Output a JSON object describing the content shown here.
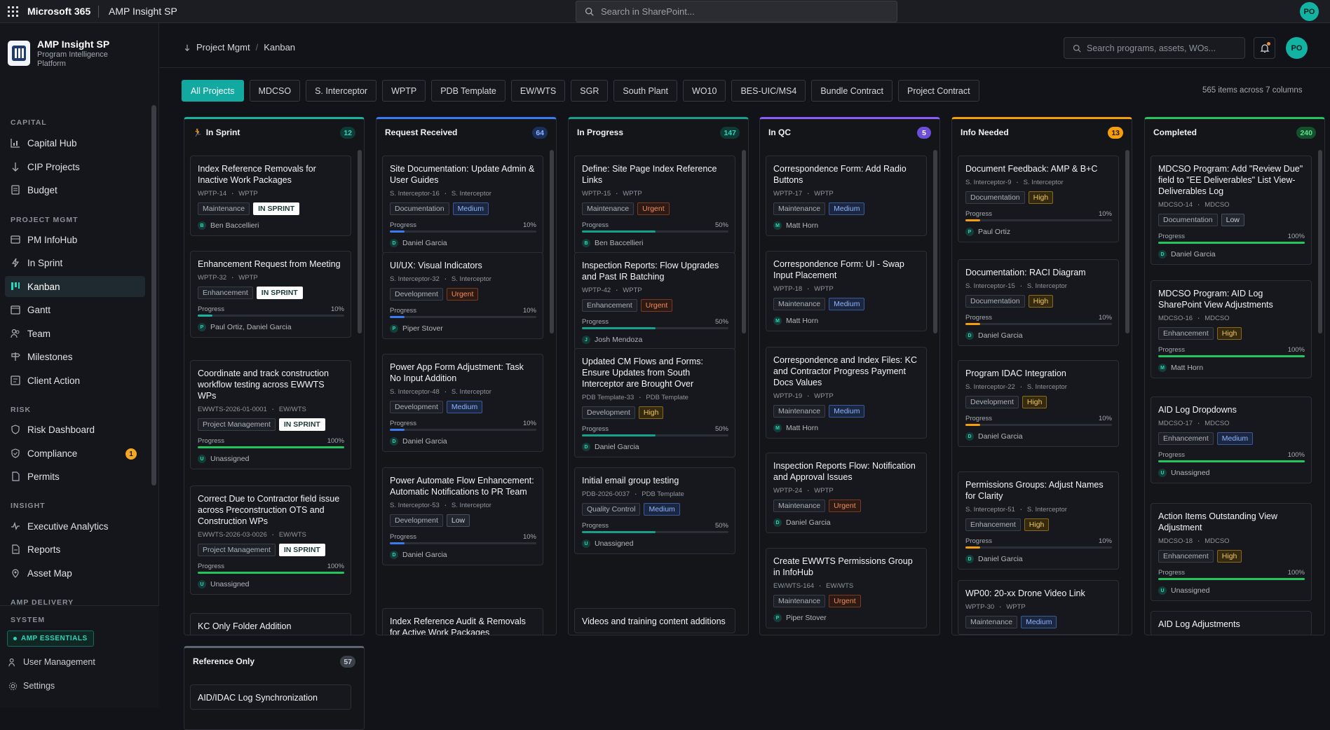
{
  "topbar": {
    "suite": "Microsoft 365",
    "app": "AMP Insight SP",
    "search_placeholder": "Search in SharePoint...",
    "avatar": "PO"
  },
  "brand": {
    "title": "AMP Insight SP",
    "subtitle": "Program Intelligence Platform"
  },
  "sidebar": {
    "sections": [
      {
        "label": "CAPITAL",
        "items": [
          {
            "label": "Capital Hub",
            "icon": "chart-icon"
          },
          {
            "label": "CIP Projects",
            "icon": "arrow-down-icon"
          },
          {
            "label": "Budget",
            "icon": "receipt-icon"
          }
        ]
      },
      {
        "label": "PROJECT MGMT",
        "items": [
          {
            "label": "PM InfoHub",
            "icon": "grid-icon"
          },
          {
            "label": "In Sprint",
            "icon": "bolt-icon"
          },
          {
            "label": "Kanban",
            "icon": "kanban-icon",
            "active": true
          },
          {
            "label": "Gantt",
            "icon": "calendar-icon"
          },
          {
            "label": "Team",
            "icon": "people-icon"
          },
          {
            "label": "Milestones",
            "icon": "signpost-icon"
          },
          {
            "label": "Client Action",
            "icon": "list-icon"
          }
        ]
      },
      {
        "label": "RISK",
        "items": [
          {
            "label": "Risk Dashboard",
            "icon": "shield-icon"
          },
          {
            "label": "Compliance",
            "icon": "shield-check-icon",
            "count": "1"
          },
          {
            "label": "Permits",
            "icon": "document-icon"
          }
        ]
      },
      {
        "label": "INSIGHT",
        "items": [
          {
            "label": "Executive Analytics",
            "icon": "pulse-icon"
          },
          {
            "label": "Reports",
            "icon": "report-icon"
          },
          {
            "label": "Asset Map",
            "icon": "pin-icon"
          }
        ]
      },
      {
        "label": "AMP DELIVERY",
        "items": []
      }
    ],
    "system": {
      "label": "SYSTEM",
      "badge": "AMP ESSENTIALS",
      "items": [
        {
          "label": "User Management"
        },
        {
          "label": "Settings"
        }
      ]
    }
  },
  "header": {
    "crumbs": [
      "Project Mgmt",
      "Kanban"
    ],
    "search_placeholder": "Search programs, assets, WOs...",
    "avatar": "PO"
  },
  "filters": [
    "All Projects",
    "MDCSO",
    "S. Interceptor",
    "WPTP",
    "PDB Template",
    "EW/WTS",
    "SGR",
    "South Plant",
    "WO10",
    "BES-UIC/MS4",
    "Bundle Contract",
    "Project Contract"
  ],
  "summary": "565 items across 7 columns",
  "labels": {
    "progress": "Progress"
  },
  "colors": {
    "accent": "#12a9a0",
    "urgent": "#f08c5a",
    "high": "#f5c65a",
    "medium": "#8fb4ff"
  },
  "columns": [
    {
      "title": "In Sprint",
      "count": "12",
      "color": "#19b3a3",
      "prefix": "🏃",
      "cards": [
        {
          "title": "Index Reference Removals for Inactive Work Packages",
          "code": "WPTP-14",
          "program": "WPTP",
          "tags": [
            "Maintenance"
          ],
          "sprint": "IN SPRINT",
          "assignee": "Ben Baccellieri",
          "initial": "B"
        },
        {
          "title": "Enhancement Request from Meeting",
          "code": "WPTP-32",
          "program": "WPTP",
          "tags": [
            "Enhancement"
          ],
          "sprint": "IN SPRINT",
          "progress": 10,
          "assignee": "Paul Ortiz, Daniel Garcia",
          "initial": "P"
        },
        {
          "title": "Coordinate and track construction workflow testing across EWWTS WPs",
          "code": "EWWTS-2026-01-0001",
          "program": "EW/WTS",
          "tags": [
            "Project Management"
          ],
          "sprint": "IN SPRINT",
          "progress": 100,
          "assignee": "Unassigned",
          "initial": "U"
        },
        {
          "title": "Correct Due to Contractor field issue across Preconstruction OTS and Construction WPs",
          "code": "EWWTS-2026-03-0026",
          "program": "EW/WTS",
          "tags": [
            "Project Management"
          ],
          "sprint": "IN SPRINT",
          "progress": 100,
          "assignee": "Unassigned",
          "initial": "U"
        },
        {
          "title": "KC Only Folder Addition"
        }
      ]
    },
    {
      "title": "Request Received",
      "count": "64",
      "color": "#3a7cf0",
      "cards": [
        {
          "title": "Site Documentation: Update Admin & User Guides",
          "code": "S. Interceptor-16",
          "program": "S. Interceptor",
          "tags": [
            "Documentation"
          ],
          "priority": "Medium",
          "progress": 10,
          "assignee": "Daniel Garcia",
          "initial": "D"
        },
        {
          "title": "UI/UX: Visual Indicators",
          "code": "S. Interceptor-32",
          "program": "S. Interceptor",
          "tags": [
            "Development"
          ],
          "priority": "Urgent",
          "progress": 10,
          "assignee": "Piper Stover",
          "initial": "P"
        },
        {
          "title": "Power App Form Adjustment: Task No Input Addition",
          "code": "S. Interceptor-48",
          "program": "S. Interceptor",
          "tags": [
            "Development"
          ],
          "priority": "Medium",
          "progress": 10,
          "assignee": "Daniel Garcia",
          "initial": "D"
        },
        {
          "title": "Power Automate Flow Enhancement: Automatic Notifications to PR Team",
          "code": "S. Interceptor-53",
          "program": "S. Interceptor",
          "tags": [
            "Development"
          ],
          "priority": "Low",
          "progress": 10,
          "assignee": "Daniel Garcia",
          "initial": "D"
        },
        {
          "title": "Index Reference Audit & Removals for Active Work Packages"
        }
      ]
    },
    {
      "title": "In Progress",
      "count": "147",
      "color": "#18a08f",
      "cards": [
        {
          "title": "Define: Site Page Index Reference Links",
          "code": "WPTP-15",
          "program": "WPTP",
          "tags": [
            "Maintenance"
          ],
          "priority": "Urgent",
          "progress": 50,
          "assignee": "Ben Baccellieri",
          "initial": "B"
        },
        {
          "title": "Inspection Reports: Flow Upgrades and Past IR Batching",
          "code": "WPTP-42",
          "program": "WPTP",
          "tags": [
            "Enhancement"
          ],
          "priority": "Urgent",
          "progress": 50,
          "assignee": "Josh Mendoza",
          "initial": "J"
        },
        {
          "title": "Updated CM Flows and Forms: Ensure Updates from South Interceptor are Brought Over",
          "code": "PDB Template-33",
          "program": "PDB Template",
          "tags": [
            "Development"
          ],
          "priority": "High",
          "progress": 50,
          "assignee": "Daniel Garcia",
          "initial": "D"
        },
        {
          "title": "Initial email group testing",
          "code": "PDB-2026-0037",
          "program": "PDB Template",
          "tags": [
            "Quality Control"
          ],
          "priority": "Medium",
          "progress": 50,
          "assignee": "Unassigned",
          "initial": "U"
        },
        {
          "title": "Videos and training content additions"
        }
      ]
    },
    {
      "title": "In QC",
      "count": "5",
      "color": "#8b5cf6",
      "cards": [
        {
          "title": "Correspondence Form: Add Radio Buttons",
          "code": "WPTP-17",
          "program": "WPTP",
          "tags": [
            "Maintenance"
          ],
          "priority": "Medium",
          "assignee": "Matt Horn",
          "initial": "M"
        },
        {
          "title": "Correspondence Form: UI - Swap Input Placement",
          "code": "WPTP-18",
          "program": "WPTP",
          "tags": [
            "Maintenance"
          ],
          "priority": "Medium",
          "assignee": "Matt Horn",
          "initial": "M"
        },
        {
          "title": "Correspondence and Index Files: KC and Contractor Progress Payment Docs Values",
          "code": "WPTP-19",
          "program": "WPTP",
          "tags": [
            "Maintenance"
          ],
          "priority": "Medium",
          "assignee": "Matt Horn",
          "initial": "M"
        },
        {
          "title": "Inspection Reports Flow: Notification and Approval Issues",
          "code": "WPTP-24",
          "program": "WPTP",
          "tags": [
            "Maintenance"
          ],
          "priority": "Urgent",
          "assignee": "Daniel Garcia",
          "initial": "D"
        },
        {
          "title": "Create EWWTS Permissions Group in InfoHub",
          "code": "EW/WTS-164",
          "program": "EW/WTS",
          "tags": [
            "Maintenance"
          ],
          "priority": "Urgent",
          "assignee": "Piper Stover",
          "initial": "P"
        }
      ]
    },
    {
      "title": "Info Needed",
      "count": "13",
      "color": "#f59e0b",
      "cards": [
        {
          "title": "Document Feedback: AMP & B+C",
          "code": "S. Interceptor-9",
          "program": "S. Interceptor",
          "tags": [
            "Documentation"
          ],
          "priority": "High",
          "progress": 10,
          "assignee": "Paul Ortiz",
          "initial": "P"
        },
        {
          "title": "Documentation: RACI Diagram",
          "code": "S. Interceptor-15",
          "program": "S. Interceptor",
          "tags": [
            "Documentation"
          ],
          "priority": "High",
          "progress": 10,
          "assignee": "Daniel Garcia",
          "initial": "D"
        },
        {
          "title": "Program IDAC Integration",
          "code": "S. Interceptor-22",
          "program": "S. Interceptor",
          "tags": [
            "Development"
          ],
          "priority": "High",
          "progress": 10,
          "assignee": "Daniel Garcia",
          "initial": "D"
        },
        {
          "title": "Permissions Groups: Adjust Names for Clarity",
          "code": "S. Interceptor-51",
          "program": "S. Interceptor",
          "tags": [
            "Enhancement"
          ],
          "priority": "High",
          "progress": 10,
          "assignee": "Daniel Garcia",
          "initial": "D"
        },
        {
          "title": "WP00: 20-xx Drone Video Link",
          "code": "WPTP-30",
          "program": "WPTP",
          "tags": [
            "Maintenance"
          ],
          "priority": "Medium"
        }
      ]
    },
    {
      "title": "Completed",
      "count": "240",
      "color": "#22c55e",
      "cards": [
        {
          "title": "MDCSO Program: Add \"Review Due\" field to \"EE Deliverables\" List View-Deliverables Log",
          "code": "MDCSO-14",
          "program": "MDCSO",
          "tags": [
            "Documentation"
          ],
          "priority": "Low",
          "progress": 100,
          "assignee": "Daniel Garcia",
          "initial": "D"
        },
        {
          "title": "MDCSO Program: AID Log SharePoint View Adjustments",
          "code": "MDCSO-16",
          "program": "MDCSO",
          "tags": [
            "Enhancement"
          ],
          "priority": "High",
          "progress": 100,
          "assignee": "Matt Horn",
          "initial": "M"
        },
        {
          "title": "AID Log Dropdowns",
          "code": "MDCSO-17",
          "program": "MDCSO",
          "tags": [
            "Enhancement"
          ],
          "priority": "Medium",
          "progress": 100,
          "assignee": "Unassigned",
          "initial": "U"
        },
        {
          "title": "Action Items Outstanding View Adjustment",
          "code": "MDCSO-18",
          "program": "MDCSO",
          "tags": [
            "Enhancement"
          ],
          "priority": "High",
          "progress": 100,
          "assignee": "Unassigned",
          "initial": "U"
        },
        {
          "title": "AID Log Adjustments"
        }
      ]
    },
    {
      "title": "Reference Only",
      "count": "57",
      "color": "#5b6472",
      "cards": [
        {
          "title": "AID/IDAC Log Synchronization"
        }
      ]
    }
  ]
}
